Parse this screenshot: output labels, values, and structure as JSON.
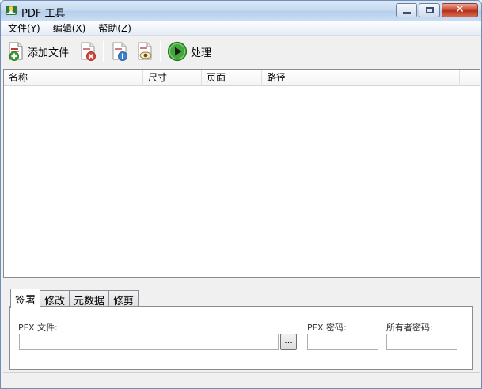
{
  "window": {
    "title": "PDF 工具"
  },
  "menu": {
    "items": [
      {
        "label": "文件(Y)"
      },
      {
        "label": "编辑(X)"
      },
      {
        "label": "帮助(Z)"
      }
    ]
  },
  "toolbar": {
    "add_file_label": "添加文件",
    "process_label": "处理"
  },
  "file_list": {
    "columns": [
      "名称",
      "尺寸",
      "页面",
      "路径"
    ],
    "rows": []
  },
  "tabs": [
    {
      "label": "签署",
      "active": true
    },
    {
      "label": "修改",
      "active": false
    },
    {
      "label": "元数据",
      "active": false
    },
    {
      "label": "修剪",
      "active": false
    }
  ],
  "sign_panel": {
    "pfx_file_label": "PFX 文件:",
    "pfx_file_value": "",
    "browse_label": "...",
    "pfx_password_label": "PFX 密码:",
    "pfx_password_value": "",
    "owner_password_label": "所有者密码:",
    "owner_password_value": ""
  },
  "colors": {
    "titlebar": "#c8dbf1",
    "close_button": "#c8432b",
    "process_green": "#3fa83a",
    "remove_red": "#d9463c",
    "info_blue": "#3d7fd1"
  }
}
